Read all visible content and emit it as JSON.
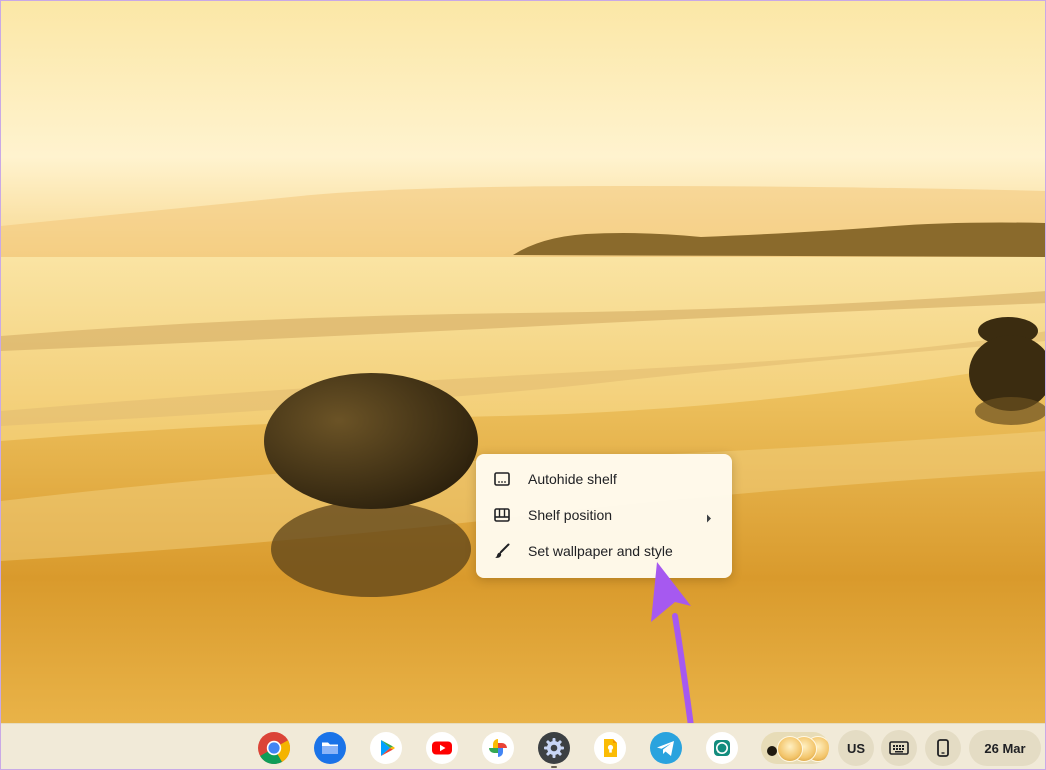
{
  "context_menu": {
    "items": [
      {
        "label": "Autohide shelf",
        "icon": "autohide-shelf-icon"
      },
      {
        "label": "Shelf position",
        "icon": "shelf-position-icon",
        "has_submenu": true
      },
      {
        "label": "Set wallpaper and style",
        "icon": "paintbrush-icon"
      }
    ]
  },
  "shelf": {
    "apps": [
      {
        "name": "chrome",
        "icon": "chrome-icon"
      },
      {
        "name": "files",
        "icon": "files-icon"
      },
      {
        "name": "play-store",
        "icon": "play-store-icon"
      },
      {
        "name": "youtube",
        "icon": "youtube-icon"
      },
      {
        "name": "google-photos",
        "icon": "google-photos-icon"
      },
      {
        "name": "settings",
        "icon": "settings-gear-icon",
        "running": true
      },
      {
        "name": "google-keep",
        "icon": "keep-icon"
      },
      {
        "name": "telegram",
        "icon": "telegram-icon"
      },
      {
        "name": "whatsapp",
        "icon": "whatsapp-icon"
      }
    ],
    "tray": {
      "ime_label": "US",
      "keyboard_icon": "keyboard-icon",
      "phone_icon": "phone-hub-icon",
      "date": "26 Mar"
    }
  },
  "colors": {
    "annotation_arrow": "#a659f0",
    "menu_background": "#fffbee",
    "shelf_background": "#f1ead8"
  }
}
